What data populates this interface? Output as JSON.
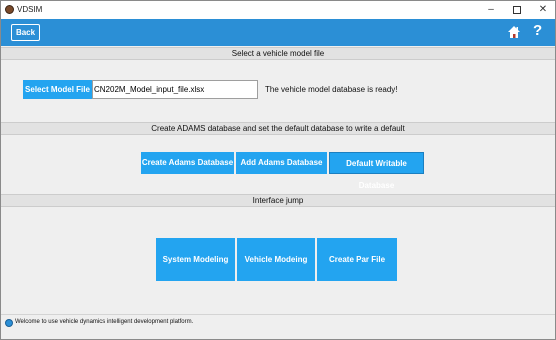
{
  "window": {
    "title": "VDSIM"
  },
  "window_controls": {
    "minimize": "–",
    "close": "✕"
  },
  "header": {
    "back_label": "Back",
    "help_label": "?"
  },
  "section_model": {
    "title": "Select a vehicle model file",
    "select_button": "Select Model File",
    "file_value": "CN202M_Model_input_file.xlsx",
    "status": "The vehicle model database is ready!"
  },
  "section_database": {
    "title": "Create ADAMS database and set the default database to write a default",
    "buttons": [
      "Create Adams Database",
      "Add Adams Database",
      "Default Writable Database"
    ]
  },
  "section_interface": {
    "title": "Interface jump",
    "buttons": [
      "System Modeling",
      "Vehicle Modeing",
      "Create Par File"
    ]
  },
  "statusbar": {
    "message": "Welcome to use vehicle dynamics intelligent development platform."
  },
  "colors": {
    "header_blue": "#2b8fd6",
    "button_blue": "#23a4f0"
  },
  "icons": {
    "home": "home-icon",
    "help": "help-icon",
    "app": "app-icon",
    "status": "info-icon"
  }
}
